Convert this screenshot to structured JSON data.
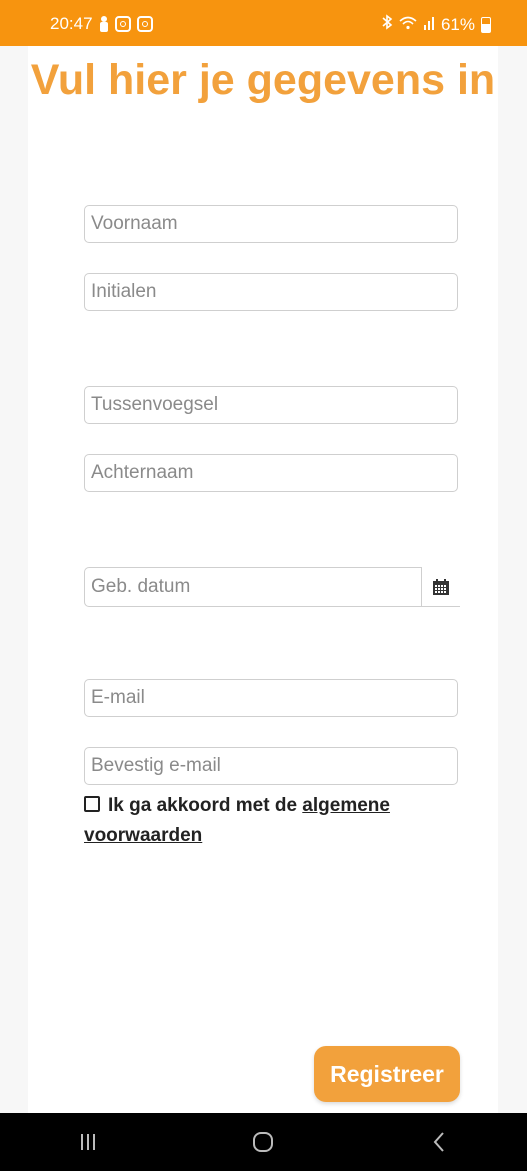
{
  "status_bar": {
    "time": "20:47",
    "battery": "61%",
    "icons": [
      "person-icon",
      "instagram-icon",
      "instagram-icon",
      "bluetooth-icon",
      "wifi-icon",
      "signal-icon",
      "battery-icon"
    ]
  },
  "form": {
    "title": "Vul hier je gegevens in",
    "fields": {
      "voornaam": "Voornaam",
      "initialen": "Initialen",
      "tussenvoegsel": "Tussenvoegsel",
      "achternaam": "Achternaam",
      "geb_datum": "Geb. datum",
      "email": "E-mail",
      "bevestig_email": "Bevestig e-mail"
    },
    "agree_text": "Ik ga akkoord met de",
    "agree_link": "algemene voorwaarden",
    "register_label": "Registreer"
  },
  "colors": {
    "status_bar": "#f7940f",
    "accent": "#f2a13c"
  }
}
